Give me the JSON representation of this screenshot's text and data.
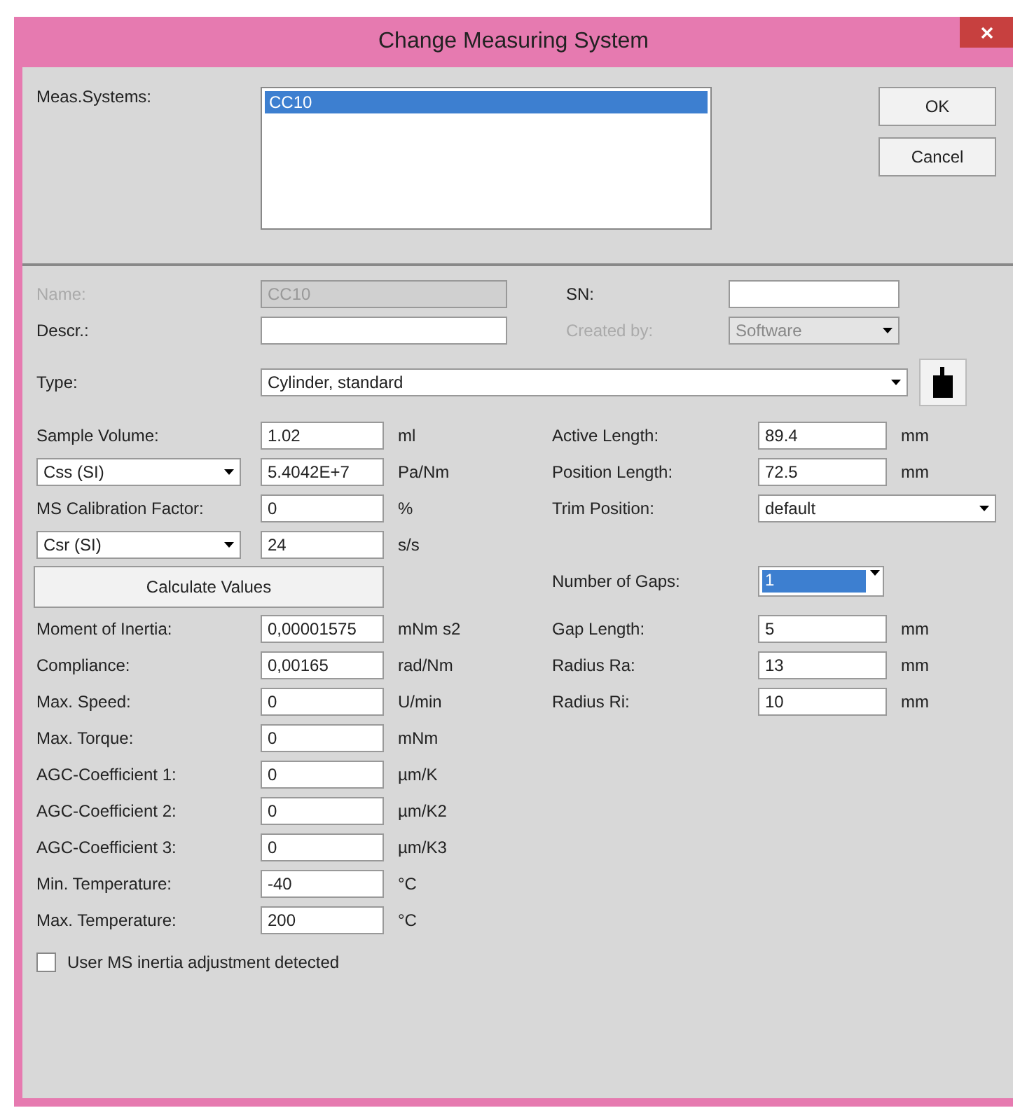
{
  "window": {
    "title": "Change Measuring System"
  },
  "meas_systems": {
    "label": "Meas.Systems:",
    "items": [
      {
        "label": "CC10",
        "selected": true
      }
    ]
  },
  "buttons": [
    "OK",
    "Cancel"
  ],
  "name": {
    "label": "Name:",
    "value": "CC10",
    "disabled": true
  },
  "sn": {
    "label": "SN:"
  },
  "descr": {
    "label": "Descr.:"
  },
  "created_by": {
    "label": "Created by:",
    "value": "Software",
    "disabled": true
  },
  "type": {
    "label": "Type:",
    "value": "Cylinder, standard"
  },
  "left_fields": [
    {
      "kind": "field",
      "label": "Sample Volume:",
      "value": "1.02",
      "unit": "ml"
    },
    {
      "kind": "unit_select",
      "selector": "Css (SI)",
      "value": "5.4042E+7",
      "unit": "Pa/Nm"
    },
    {
      "kind": "field",
      "label": "MS Calibration Factor:",
      "value": "0",
      "unit": "%"
    },
    {
      "kind": "unit_select",
      "selector": "Csr (SI)",
      "value": "24",
      "unit": "s/s"
    },
    {
      "kind": "button",
      "label": "Calculate Values"
    },
    {
      "kind": "field",
      "label": "Moment of Inertia:",
      "value": "0,00001575",
      "unit": "mNm s2"
    },
    {
      "kind": "field",
      "label": "Compliance:",
      "value": "0,00165",
      "unit": "rad/Nm"
    },
    {
      "kind": "field",
      "label": "Max. Speed:",
      "value": "0",
      "unit": "U/min"
    },
    {
      "kind": "field",
      "label": "Max. Torque:",
      "value": "0",
      "unit": "mNm"
    },
    {
      "kind": "field",
      "label": "AGC-Coefficient 1:",
      "value": "0",
      "unit": "µm/K"
    },
    {
      "kind": "field",
      "label": "AGC-Coefficient 2:",
      "value": "0",
      "unit": "µm/K2"
    },
    {
      "kind": "field",
      "label": "AGC-Coefficient 3:",
      "value": "0",
      "unit": "µm/K3"
    },
    {
      "kind": "field",
      "label": "Min. Temperature:",
      "value": "-40",
      "unit": "°C"
    },
    {
      "kind": "field",
      "label": "Max. Temperature:",
      "value": "200",
      "unit": "°C"
    }
  ],
  "right_fields_top": [
    {
      "kind": "field",
      "label": "Active Length:",
      "value": "89.4",
      "unit": "mm"
    },
    {
      "kind": "field",
      "label": "Position Length:",
      "value": "72.5",
      "unit": "mm"
    },
    {
      "kind": "dropdown",
      "label": "Trim Position:",
      "value": "default"
    }
  ],
  "right_fields_bottom": [
    {
      "kind": "number_select",
      "label": "Number of Gaps:",
      "value": "1"
    },
    {
      "kind": "field",
      "label": "Gap Length:",
      "value": "5",
      "unit": "mm"
    },
    {
      "kind": "field",
      "label": "Radius Ra:",
      "value": "13",
      "unit": "mm"
    },
    {
      "kind": "field",
      "label": "Radius Ri:",
      "value": "10",
      "unit": "mm"
    }
  ],
  "checkbox": {
    "label": "User MS inertia adjustment detected",
    "checked": false
  }
}
